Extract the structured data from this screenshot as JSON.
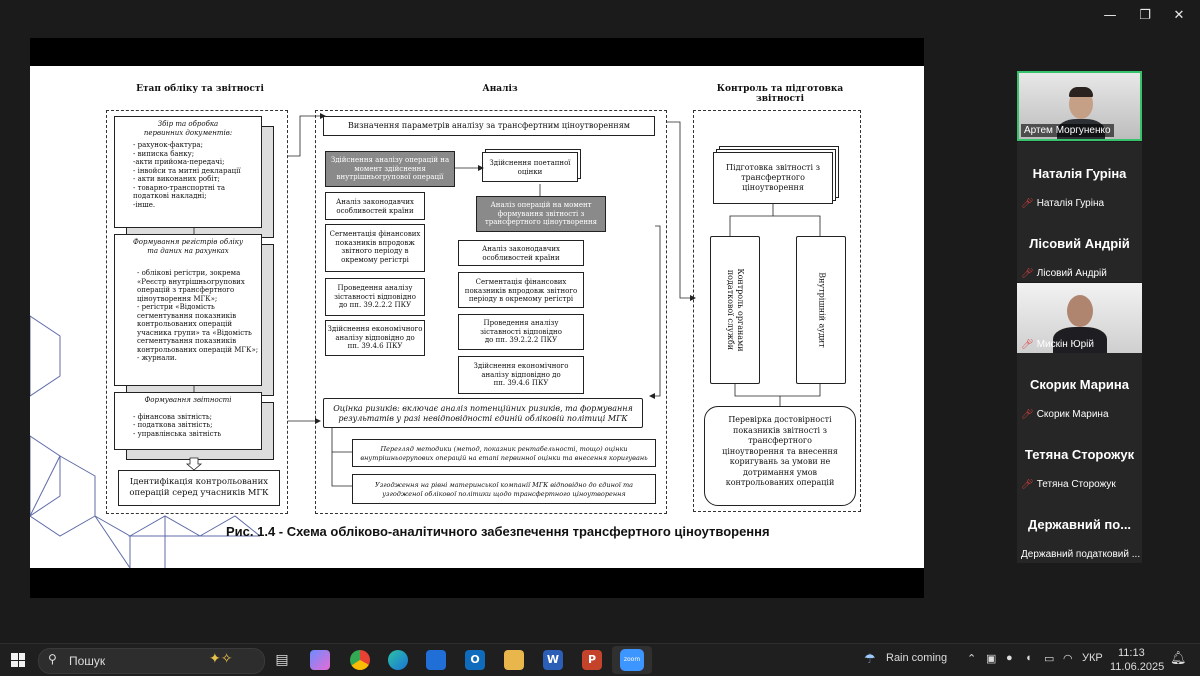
{
  "window_controls": {
    "minimize": "—",
    "restore": "❐",
    "close": "✕"
  },
  "slide": {
    "col1_title": "Етап обліку та звітності",
    "col2_title": "Аналіз",
    "col3_title": "Контроль та підготовка\nзвітності",
    "c1_box1_title": "Збір та обробка\nпервинних документів:",
    "c1_box1_items": "- рахунок-фактура;\n- виписка банку;\n-акти прийома-передачі;\n- інвойси та митні декларації\n- акти виконаних робіт;\n- товарно-транспортні та\n   податкові накладні;\n-інше.",
    "c1_box2_title": "Формування регістрів обліку\nта даних на рахунках",
    "c1_box2_items": "- облікові регістри, зокрема\n«Реєстр внутрішньогрупових\nоперацій з трансфертного\nціноутворення МГК»;\n- регістри «Відомість\nсегментування показників\nконтрольованих операцій\nучасника групи» та «Відомість\nсегментування показників\nконтрольованих операцій МГК»;\n- журнали.",
    "c1_box3_title": "Формування звітності",
    "c1_box3_items": "- фінансова звітність;\n- податкова звітність;\n- управлінська звітність",
    "c1_box4": "Ідентифікація контрольованих\nоперацій серед учасників МГК",
    "c2_top": "Визначення параметрів аналізу за трансфертним ціноутворенням",
    "c2_gray1": "Здійснення аналізу операцій на\nмомент здійснення\nвнутрішньогрупової операції",
    "c2_post": "Здійснення поетапної\nоцінки",
    "c2_gray2": "Аналіз операцій на момент\nформування звітності з\nтрансфертного ціноутворення",
    "c2_left_items": [
      "Аналіз законодавчих\nособливостей країни",
      "Сегментація фінансових\nпоказників впродовж\nзвітного періоду в\nокремому регістрі",
      "Проведення аналізу\nзіставності відповідно\nдо пп. 39.2.2.2 ПКУ",
      "Здійснення економічного\nаналізу відповідно до\nпп. 39.4.6 ПКУ"
    ],
    "c2_right_items": [
      "Аналіз законодавчих\nособливостей країни",
      "Сегментація фінансових\nпоказників впродовж звітного\nперіоду в окремому регістрі",
      "Проведення аналізу\nзіставності відповідно\nдо пп. 39.2.2.2 ПКУ",
      "Здійснення економічного\nаналізу відповідно до\nпп. 39.4.6 ПКУ"
    ],
    "c2_risk": "Оцінка ризиків: включає аналіз потенційних ризиків, та формування\nрезультатів у разі невідповідності єдиній обліковій політиці МГК",
    "c2_review": "Перегляд методики (метод, показник рентабельності, тощо) оцінки\nвнутрішньогрупових операцій на етапі первинної оцінки та внесення коригувань",
    "c2_align": "Узгодження на рівні материнської компанії МГК відповідно до єдиної та\nузгодженої облікової політики щодо трансфертного ціноутворення",
    "c3_docs": "Підготовка звітності з\nтрансфертного\nціноутворення",
    "c3_col1": "Контроль органами\nподаткової служби",
    "c3_col2": "Внутрішній аудит",
    "c3_bottom": "Перевірка достовірності\nпоказників звітності з\nтрансфертного\nціноутворення та внесення\nкоригувань за умови не\nдотримання умов\nконтрольованих операцій",
    "caption": "Рис. 1.4 - Схема обліково-аналітичного забезпечення трансфертного ціноутворення"
  },
  "participants": [
    {
      "display": "",
      "name": "Артем Моргуненко",
      "video": true
    },
    {
      "display": "Наталія Гуріна",
      "name": "Наталія Гуріна",
      "video": false
    },
    {
      "display": "Лісовий Андрій",
      "name": "Лісовий Андрій",
      "video": false
    },
    {
      "display": "",
      "name": "Мискін Юрій",
      "video": true
    },
    {
      "display": "Скорик Марина",
      "name": "Скорик Марина",
      "video": false
    },
    {
      "display": "Тетяна Сторожук",
      "name": "Тетяна Сторожук",
      "video": false
    },
    {
      "display": "Державний по...",
      "name": "Державний податковий ...",
      "video": false
    }
  ],
  "taskbar": {
    "search_placeholder": "Пошук",
    "weather": "Rain coming",
    "lang": "УКР",
    "time": "11:13",
    "date": "11.06.2025"
  }
}
